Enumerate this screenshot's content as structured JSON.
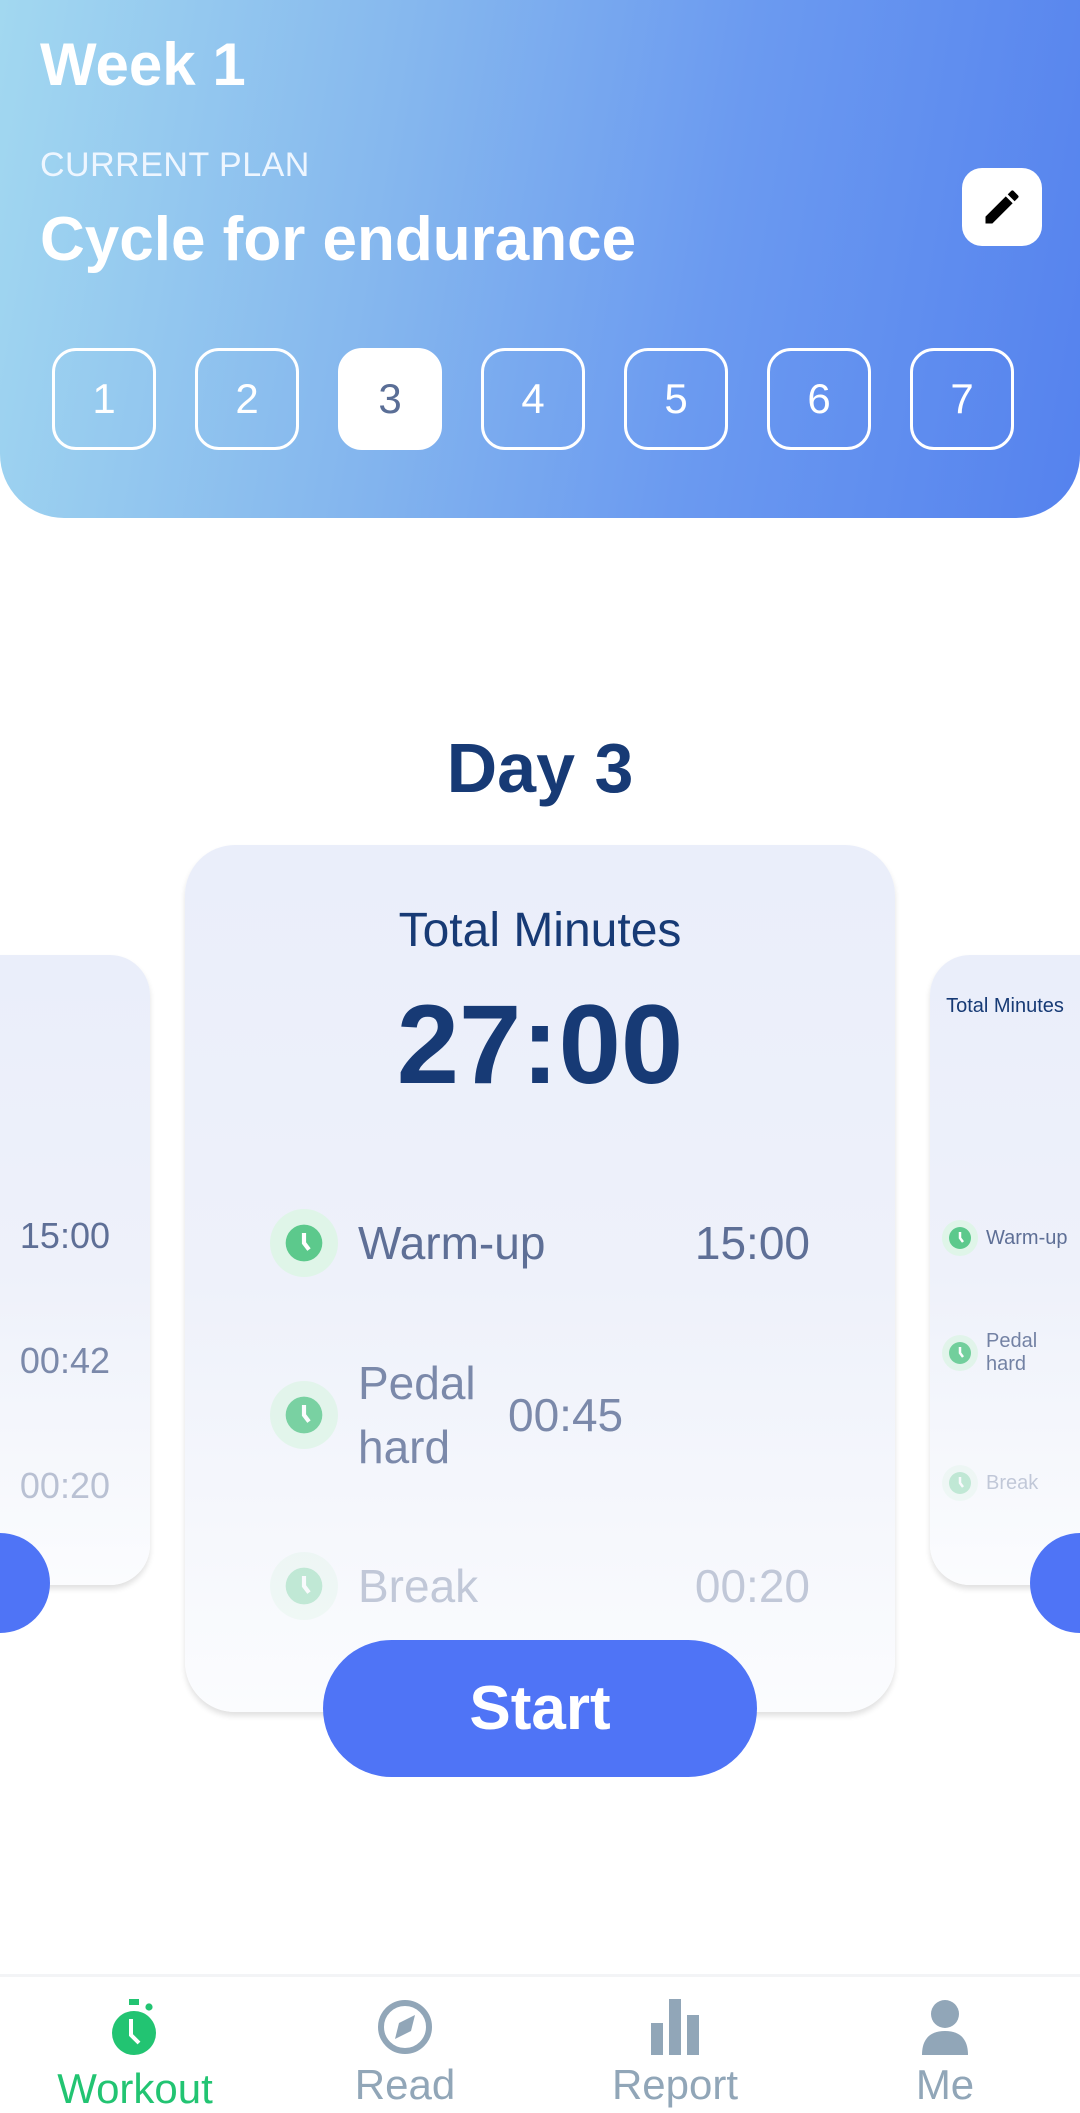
{
  "header": {
    "week": "Week 1",
    "plan_label": "CURRENT PLAN",
    "plan_name": "Cycle for endurance",
    "edit_icon": "pencil-icon",
    "days": [
      "1",
      "2",
      "3",
      "4",
      "5",
      "6",
      "7"
    ],
    "selected_day": "3"
  },
  "day_title": "Day 3",
  "card": {
    "total_label": "Total Minutes",
    "total": "27:00",
    "rows": [
      {
        "label": "Warm-up",
        "value": "15:00"
      },
      {
        "label": "Pedal hard",
        "value": "00:45"
      },
      {
        "label": "Break",
        "value": "00:20"
      }
    ],
    "start": "Start"
  },
  "prev_card": {
    "values": [
      "15:00",
      "00:42",
      "00:20"
    ]
  },
  "next_card": {
    "total_label": "Total Minutes",
    "rows": [
      "Warm-up",
      "Pedal hard",
      "Break"
    ]
  },
  "colors": {
    "accent": "#4f74f6",
    "title": "#173a75",
    "active_tab": "#22c472",
    "inactive_tab": "#91a6b8"
  },
  "nav": [
    {
      "label": "Workout",
      "icon": "stopwatch-icon"
    },
    {
      "label": "Read",
      "icon": "compass-icon"
    },
    {
      "label": "Report",
      "icon": "bar-chart-icon"
    },
    {
      "label": "Me",
      "icon": "person-icon"
    }
  ]
}
